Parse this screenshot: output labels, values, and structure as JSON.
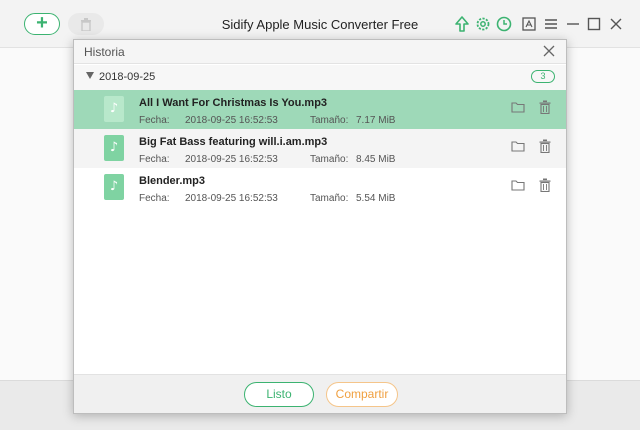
{
  "app": {
    "title": "Sidify Apple Music Converter Free",
    "add_symbol": "+",
    "icons": [
      "plus-icon",
      "trash-icon",
      "upload-icon",
      "gear-icon",
      "clock-icon",
      "register-icon",
      "menu-icon",
      "minimize-icon",
      "maximize-icon",
      "close-icon"
    ]
  },
  "dialog": {
    "title": "Historia",
    "group": {
      "date": "2018-09-25",
      "count": "3"
    },
    "items": [
      {
        "name": "All I Want For Christmas Is You.mp3",
        "fecha_label": "Fecha:",
        "fecha": "2018-09-25 16:52:53",
        "size_label": "Tamaño:",
        "size": "7.17 MiB",
        "selected": true
      },
      {
        "name": "Big Fat Bass featuring will.i.am.mp3",
        "fecha_label": "Fecha:",
        "fecha": "2018-09-25 16:52:53",
        "size_label": "Tamaño:",
        "size": "8.45 MiB",
        "selected": false
      },
      {
        "name": "Blender.mp3",
        "fecha_label": "Fecha:",
        "fecha": "2018-09-25 16:52:53",
        "size_label": "Tamaño:",
        "size": "5.54 MiB",
        "selected": false
      }
    ],
    "footer": {
      "done_label": "Listo",
      "share_label": "Compartir"
    }
  },
  "colors": {
    "accent": "#3cb371",
    "selected_row": "#9ed9b8",
    "share": "#f0a040"
  }
}
